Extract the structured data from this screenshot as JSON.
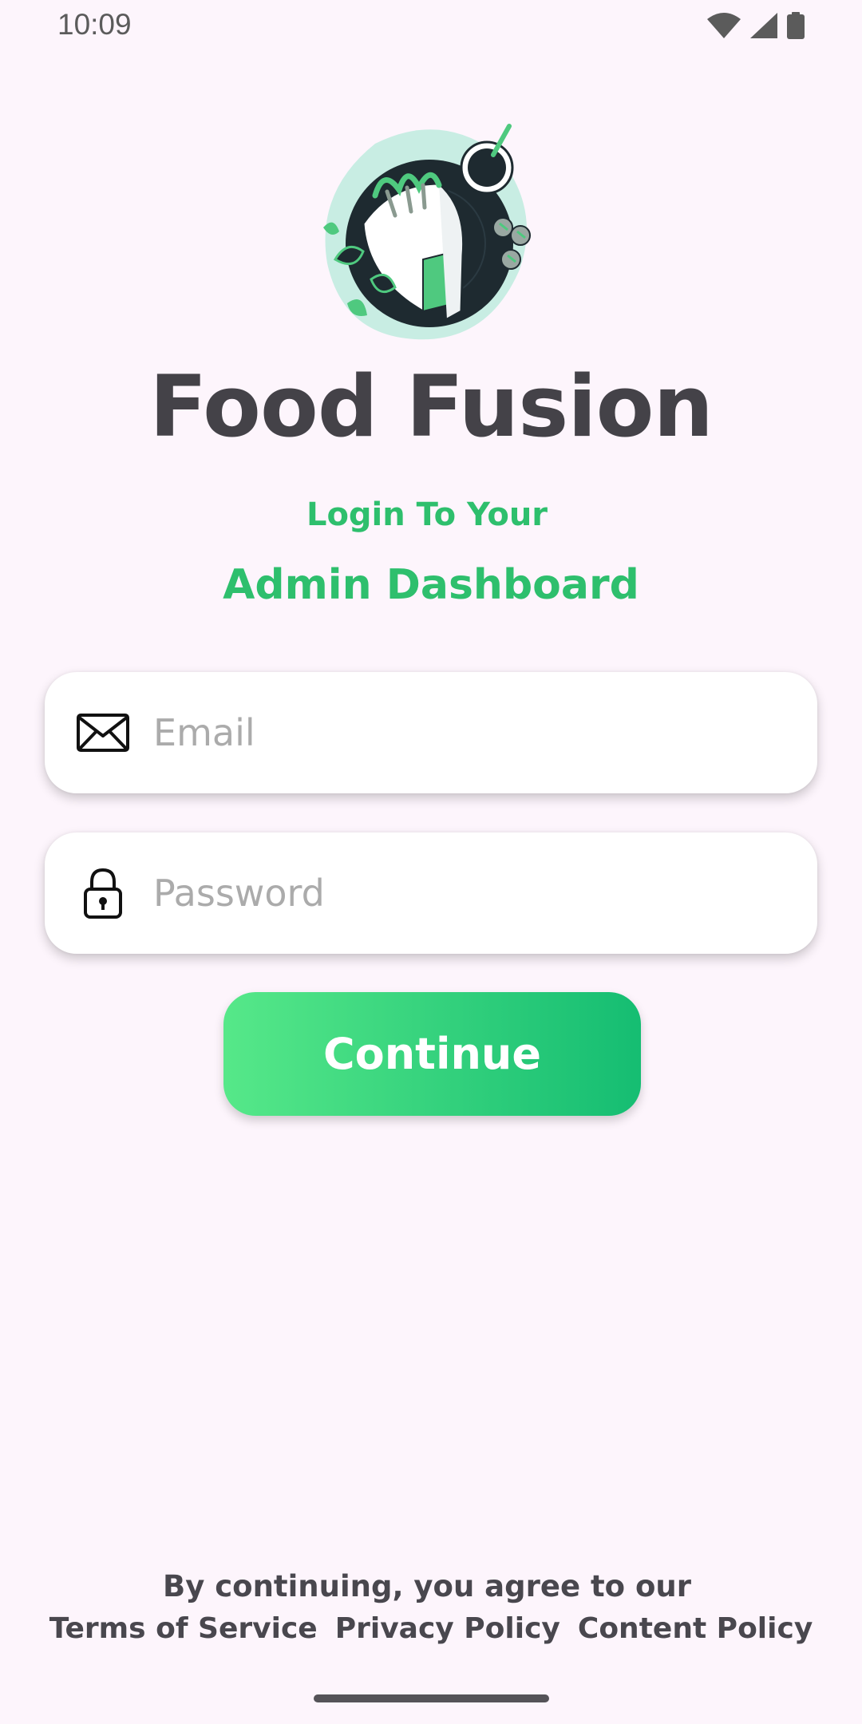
{
  "status_bar": {
    "time": "10:09",
    "icons": [
      "wifi-icon",
      "cellular-signal-icon",
      "battery-icon"
    ]
  },
  "logo": {
    "icon": "food-wrap-illustration",
    "colors": {
      "blob": "#c8ede3",
      "plate": "#1e2a30",
      "accent": "#4fc97f"
    }
  },
  "app_title": "Food Fusion",
  "subtitle_line1": "Login To Your",
  "subtitle_line2": "Admin Dashboard",
  "form": {
    "email": {
      "placeholder": "Email",
      "value": "",
      "icon": "envelope-icon"
    },
    "password": {
      "placeholder": "Password",
      "value": "",
      "icon": "lock-icon"
    },
    "continue_label": "Continue"
  },
  "footer": {
    "agree_text": "By continuing, you agree to our",
    "links": [
      "Terms of Service",
      "Privacy Policy",
      "Content Policy"
    ]
  },
  "colors": {
    "background": "#fdf5fc",
    "accent": "#2ebf6d",
    "button_gradient_start": "#56e889",
    "button_gradient_end": "#15bd72",
    "title": "#444248"
  }
}
